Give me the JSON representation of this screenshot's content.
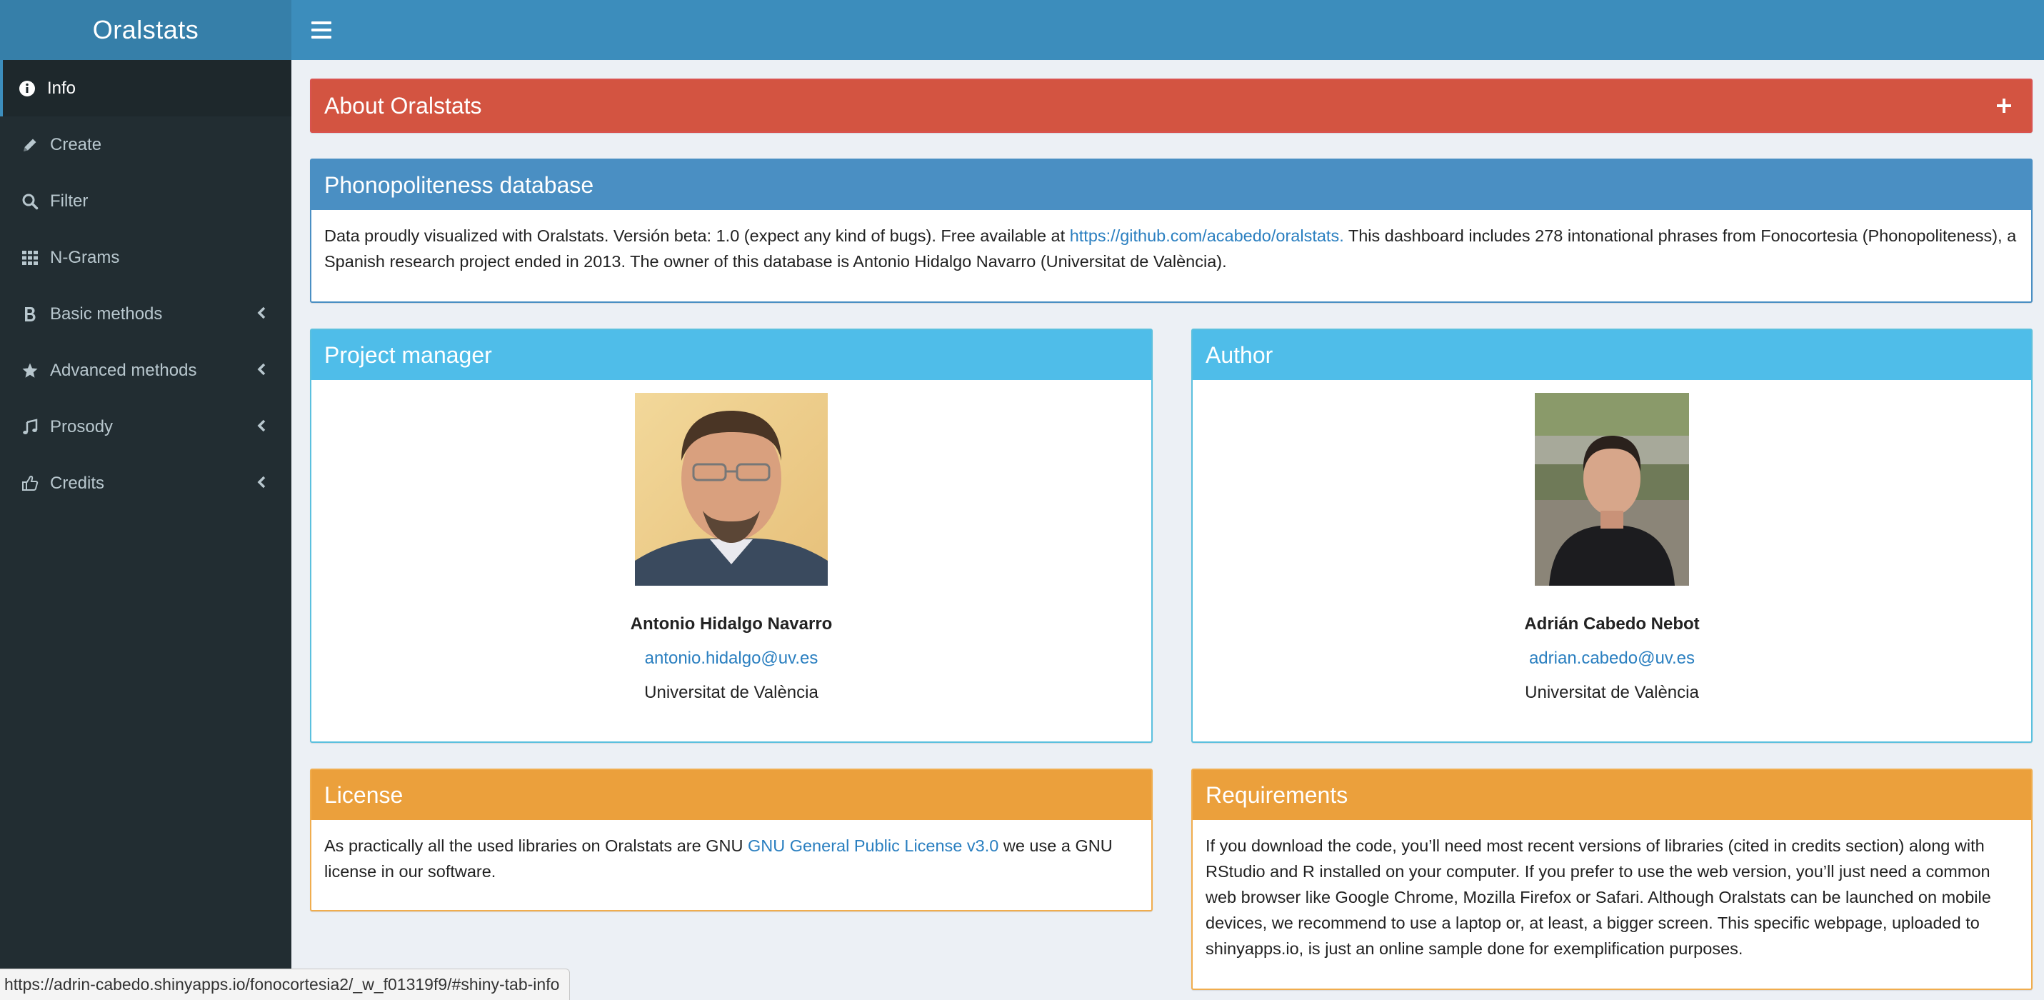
{
  "app": {
    "title": "Oralstats"
  },
  "sidebar": {
    "items": [
      {
        "label": "Info",
        "icon": "info-circle-icon",
        "active": true
      },
      {
        "label": "Create",
        "icon": "pencil-icon"
      },
      {
        "label": "Filter",
        "icon": "search-icon"
      },
      {
        "label": "N-Grams",
        "icon": "grid-icon"
      },
      {
        "label": "Basic methods",
        "icon": "bold-icon",
        "has_submenu": true
      },
      {
        "label": "Advanced methods",
        "icon": "star-icon",
        "has_submenu": true
      },
      {
        "label": "Prosody",
        "icon": "music-icon",
        "has_submenu": true
      },
      {
        "label": "Credits",
        "icon": "thumbs-up-icon",
        "has_submenu": true
      }
    ]
  },
  "boxes": {
    "about": {
      "title": "About Oralstats"
    },
    "database": {
      "title": "Phonopoliteness database",
      "text_before": "Data proudly visualized with Oralstats. Versión beta: 1.0 (expect any kind of bugs). Free available at ",
      "link": "https://github.com/acabedo/oralstats.",
      "text_after": " This dashboard includes 278 intonational phrases from Fonocortesia (Phonopoliteness), a Spanish research project ended in 2013. The owner of this database is Antonio Hidalgo Navarro (Universitat de València)."
    },
    "manager": {
      "title": "Project manager",
      "name": "Antonio Hidalgo Navarro",
      "email": "antonio.hidalgo@uv.es",
      "institution": "Universitat de València"
    },
    "author": {
      "title": "Author",
      "name": "Adrián Cabedo Nebot",
      "email": "adrian.cabedo@uv.es",
      "institution": "Universitat de València"
    },
    "license": {
      "title": "License",
      "text_before": "As practically all the used libraries on Oralstats are GNU ",
      "link": "GNU General Public License v3.0",
      "text_after": " we use a GNU license in our software."
    },
    "requirements": {
      "title": "Requirements",
      "text": "If you download the code, you’ll need most recent versions of libraries (cited in credits section) along with RStudio and R installed on your computer. If you prefer to use the web version, you’ll just need a common web browser like Google Chrome, Mozilla Firefox or Safari. Although Oralstats can be launched on mobile devices, we recommend to use a laptop or, at least, a bigger screen. This specific webpage, uploaded to shinyapps.io, is just an online sample done for exemplification purposes."
    }
  },
  "status_url": "https://adrin-cabedo.shinyapps.io/fonocortesia2/_w_f01319f9/#shiny-tab-info",
  "colors": {
    "header": "#3c8dbc",
    "sidebar": "#222d32",
    "red": "#d35441",
    "blue": "#4a8fc3",
    "cyan": "#4fbde9",
    "orange": "#eba03c"
  }
}
